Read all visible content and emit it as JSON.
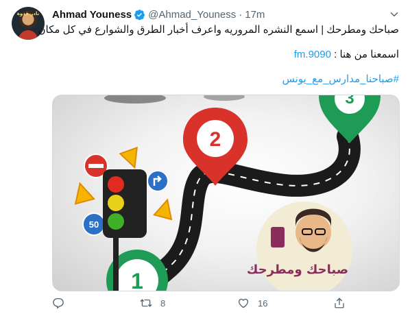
{
  "tweet": {
    "author_name": "Ahmad Youness",
    "handle": "@Ahmad_Youness",
    "separator": "·",
    "time": "17m",
    "avatar_text": "نادر قدوة",
    "text_line1": "صباحك ومطرحك | اسمع النشره المروريه واعرف أخبار الطرق والشوارع في كل مكان",
    "text_line2_prefix": "اسمعنا من هنا : ",
    "text_line2_link": "9090.fm",
    "hashtag": "#صباحنا_مدارس_مع_يونس",
    "media": {
      "pin_numbers": [
        "1",
        "2",
        "3"
      ],
      "speed_sign": "50",
      "badge_text": "صباحك ومطرحك"
    },
    "actions": {
      "retweets": "8",
      "likes": "16"
    }
  },
  "colors": {
    "link": "#1d9bf0",
    "secondary": "#536471",
    "verified": "#1d9bf0",
    "pin_red": "#d9322b",
    "pin_green": "#1e9b55",
    "road": "#1b1b1b"
  },
  "icons": [
    "verified-badge-icon",
    "caret-down-icon",
    "reply-icon",
    "retweet-icon",
    "like-icon",
    "share-icon"
  ]
}
